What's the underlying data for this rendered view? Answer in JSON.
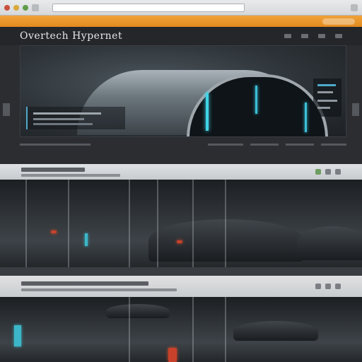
{
  "browser": {
    "address_value": "",
    "controls": [
      "close-icon",
      "minimize-icon",
      "maximize-icon",
      "back-icon",
      "forward-icon",
      "reload-icon"
    ]
  },
  "tabbar": {
    "label": "",
    "accent_color": "#e48b1e"
  },
  "header": {
    "title": "Overtech Hypernet"
  },
  "hero": {
    "icons": [
      "play-icon",
      "info-icon"
    ]
  },
  "cards": [
    {
      "icons": [
        "share-icon",
        "like-icon",
        "more-icon"
      ]
    },
    {
      "icons": [
        "comment-icon",
        "share-icon",
        "more-icon"
      ]
    }
  ]
}
